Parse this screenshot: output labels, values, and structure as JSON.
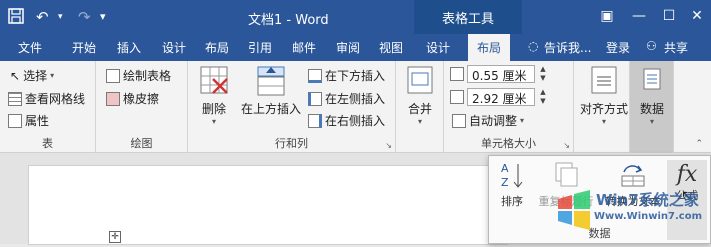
{
  "title_bar": {
    "window_title": "文档1 - Word",
    "context_title": "表格工具",
    "qat": {
      "save_icon": "save-icon",
      "undo": "↶",
      "redo": "↷"
    }
  },
  "tabs": [
    "文件",
    "开始",
    "插入",
    "设计",
    "布局",
    "引用",
    "邮件",
    "审阅",
    "视图",
    "设计",
    "布局"
  ],
  "tell_me": "告诉我...",
  "login": "登录",
  "share": "共享",
  "groups": {
    "table": {
      "label": "表",
      "select": "选择",
      "gridlines": "查看网格线",
      "properties": "属性"
    },
    "draw": {
      "label": "绘图",
      "draw_table": "绘制表格",
      "eraser": "橡皮擦"
    },
    "rows_cols": {
      "label": "行和列",
      "delete": "删除",
      "insert_above": "在上方插入",
      "insert_below": "在下方插入",
      "insert_left": "在左侧插入",
      "insert_right": "在右侧插入"
    },
    "merge": {
      "label": "合并"
    },
    "cell_size": {
      "label": "单元格大小",
      "height": "0.55 厘米",
      "width": "2.92 厘米",
      "autofit": "自动调整"
    },
    "alignment": {
      "label": "对齐方式"
    },
    "data": {
      "label": "数据"
    }
  },
  "popup": {
    "sort": "排序",
    "repeat_header": "重复标题行",
    "convert_text": "转换为文本",
    "formula": "公式",
    "group_label": "数据"
  },
  "watermark": {
    "text1": "Win7系统之家",
    "text2": "Www.Winwin7.com"
  },
  "colors": {
    "title_blue": "#2b579a",
    "ribbon_bg": "#f3f3f3"
  }
}
